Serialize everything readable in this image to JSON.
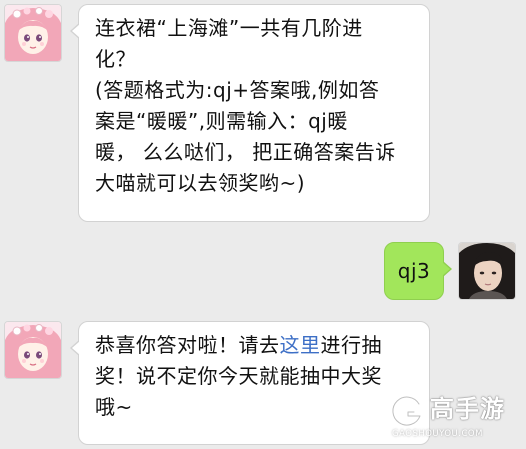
{
  "messages": [
    {
      "side": "left",
      "sender": "official-account",
      "lines": [
        "连衣裙“上海滩”一共有几阶进",
        "化？",
        "(答题格式为:qj+答案哦,例如答",
        "案是“暖暖”,则需输入：qj暖",
        "暖， 么么哒们， 把正确答案告诉",
        "大喵就可以去领奖哟~)"
      ]
    },
    {
      "side": "right",
      "sender": "user",
      "text": "qj3"
    },
    {
      "side": "left",
      "sender": "official-account",
      "line1_before": "恭喜你答对啦！请去",
      "line1_link": "这里",
      "line1_after": "进行抽",
      "line2": "奖！说不定你今天就能抽中大奖",
      "line3": "哦~"
    }
  ],
  "watermark": {
    "name": "高手游",
    "domain": "GAOSHOUYOU.COM"
  },
  "colors": {
    "background": "#ebebeb",
    "incoming_bubble": "#ffffff",
    "outgoing_bubble": "#a2e65b",
    "link": "#3d6fc6"
  },
  "icons": {
    "official_avatar": "anime-girl-avatar-icon",
    "user_avatar": "user-photo-avatar-icon",
    "watermark_logo": "gaoshouyou-logo-icon"
  }
}
